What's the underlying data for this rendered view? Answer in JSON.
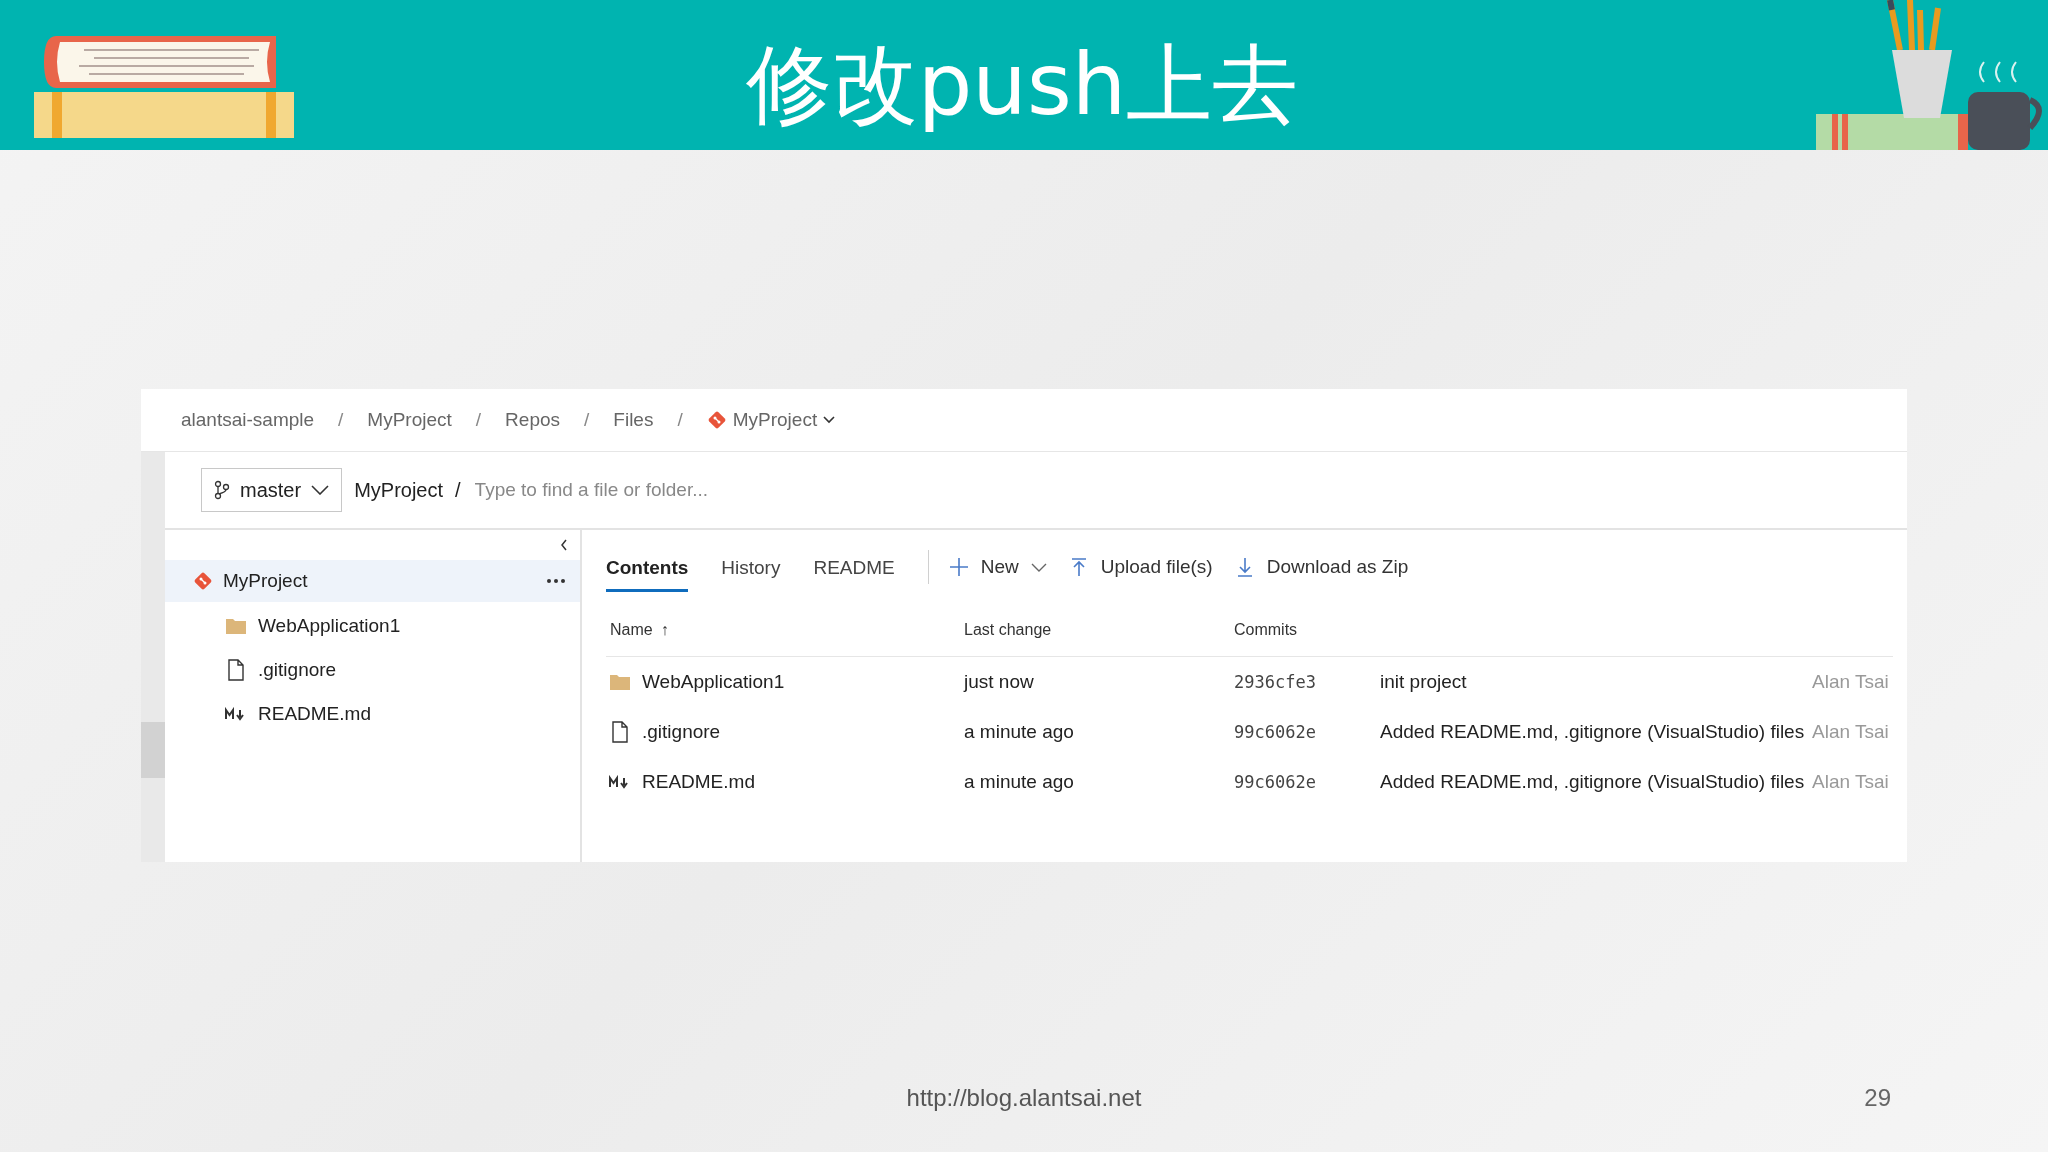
{
  "slide": {
    "title": "修改push上去",
    "footer_url": "http://blog.alantsai.net",
    "page_number": "29"
  },
  "breadcrumb": {
    "items": [
      {
        "label": "alantsai-sample",
        "kind": "text"
      },
      {
        "label": "MyProject",
        "kind": "text"
      },
      {
        "label": "Repos",
        "kind": "text"
      },
      {
        "label": "Files",
        "kind": "text"
      },
      {
        "label": "MyProject",
        "kind": "repo"
      }
    ],
    "separators": [
      "/",
      "/",
      "/",
      "/"
    ]
  },
  "branch": {
    "label": "master"
  },
  "path": {
    "root": "MyProject",
    "separator": "/",
    "placeholder": "Type to find a file or folder..."
  },
  "tree": {
    "label": "MyProject",
    "selected": true,
    "children": [
      {
        "label": "WebApplication1",
        "kind": "folder"
      },
      {
        "label": ".gitignore",
        "kind": "file"
      },
      {
        "label": "README.md",
        "kind": "markdown"
      }
    ]
  },
  "tabs": [
    {
      "label": "Contents",
      "selected": true
    },
    {
      "label": "History",
      "selected": false
    },
    {
      "label": "README",
      "selected": false
    }
  ],
  "actions": [
    {
      "label": "New",
      "kind": "new"
    },
    {
      "label": "Upload file(s)",
      "kind": "upload"
    },
    {
      "label": "Download as Zip",
      "kind": "download"
    }
  ],
  "table": {
    "columns": [
      "Name",
      "Last change",
      "Commits"
    ],
    "sort_arrow": "↑",
    "rows": [
      {
        "kind": "folder",
        "name": "WebApplication1",
        "last_change": "just now",
        "commit": "2936cfe3",
        "message": "init project",
        "author": "Alan Tsai"
      },
      {
        "kind": "file",
        "name": ".gitignore",
        "last_change": "a minute ago",
        "commit": "99c6062e",
        "message": "Added README.md, .gitignore (VisualStudio) files",
        "author": "Alan Tsai"
      },
      {
        "kind": "markdown",
        "name": "README.md",
        "last_change": "a minute ago",
        "commit": "99c6062e",
        "message": "Added README.md, .gitignore (VisualStudio) files",
        "author": "Alan Tsai"
      }
    ]
  }
}
